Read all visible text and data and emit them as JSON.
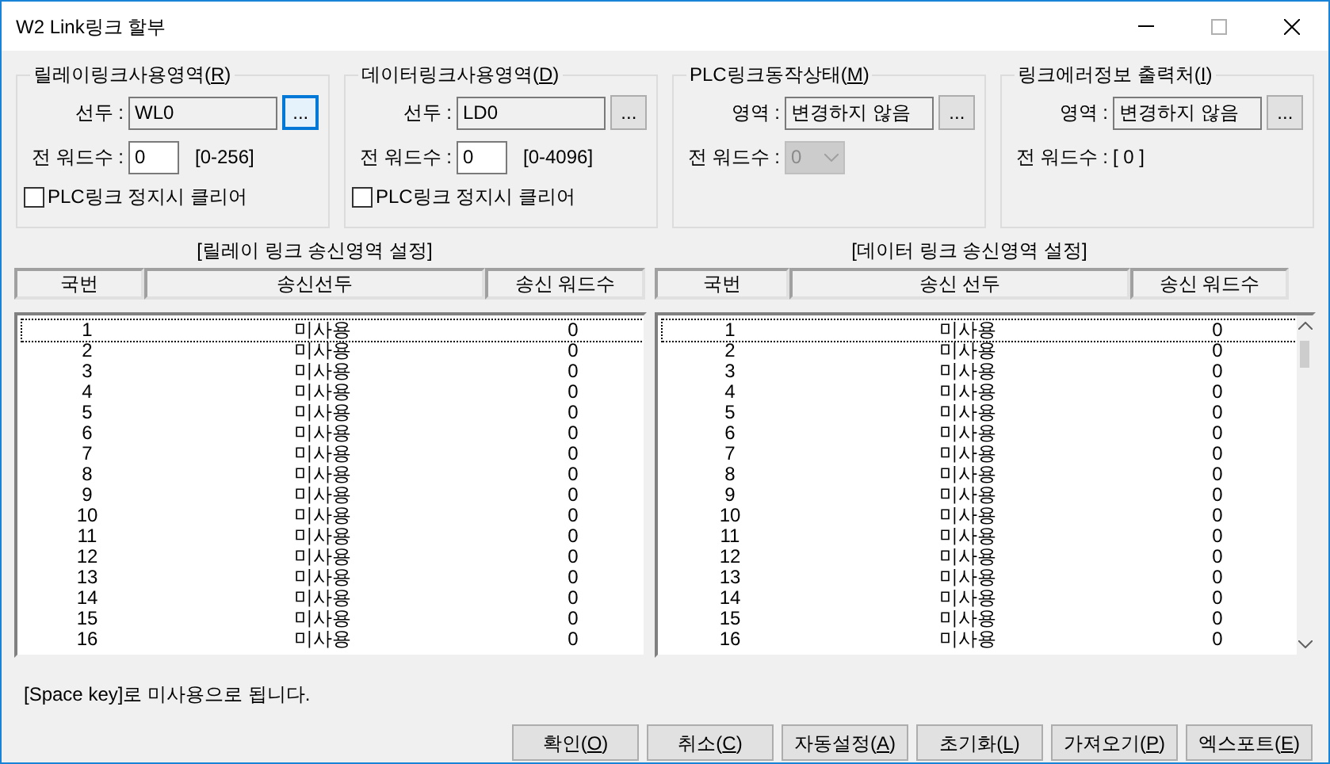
{
  "window": {
    "title": "W2 Link링크 할부"
  },
  "groups": [
    {
      "title": "릴레이링크사용영역(R)",
      "items": [
        {
          "kind": "field",
          "label": "선두 :",
          "value": "WL0",
          "button": "...",
          "focused": true
        },
        {
          "kind": "count",
          "label": "전 워드수 :",
          "value": "0",
          "hint": "[0-256]"
        },
        {
          "kind": "checkbox",
          "label": "PLC링크 정지시 클리어",
          "checked": false
        }
      ]
    },
    {
      "title": "데이터링크사용영역(D)",
      "items": [
        {
          "kind": "field",
          "label": "선두 :",
          "value": "LD0",
          "button": "...",
          "focused": false
        },
        {
          "kind": "count",
          "label": "전 워드수 :",
          "value": "0",
          "hint": "[0-4096]"
        },
        {
          "kind": "checkbox",
          "label": "PLC링크 정지시 클리어",
          "checked": false
        }
      ]
    },
    {
      "title": "PLC링크동작상태(M)",
      "items": [
        {
          "kind": "field",
          "label": "영역 :",
          "value": "변경하지 않음",
          "button": "...",
          "focused": false
        },
        {
          "kind": "combo",
          "label": "전 워드수 :",
          "value": "0",
          "disabled": true
        }
      ]
    },
    {
      "title": "링크에러정보 출력처(I)",
      "items": [
        {
          "kind": "field",
          "label": "영역 :",
          "value": "변경하지 않음",
          "button": "...",
          "focused": false
        },
        {
          "kind": "reading",
          "label": "전 워드수 :",
          "value": "[ 0 ]"
        }
      ]
    }
  ],
  "tables": [
    {
      "title": "[릴레이 링크 송신영역 설정]",
      "columns": [
        "국번",
        "송신선두",
        "송신 워드수"
      ],
      "rows": [
        {
          "no": "1",
          "prefix": "미사용",
          "words": "0",
          "selected": true
        },
        {
          "no": "2",
          "prefix": "미사용",
          "words": "0",
          "selected": false
        },
        {
          "no": "3",
          "prefix": "미사용",
          "words": "0",
          "selected": false
        },
        {
          "no": "4",
          "prefix": "미사용",
          "words": "0",
          "selected": false
        },
        {
          "no": "5",
          "prefix": "미사용",
          "words": "0",
          "selected": false
        },
        {
          "no": "6",
          "prefix": "미사용",
          "words": "0",
          "selected": false
        },
        {
          "no": "7",
          "prefix": "미사용",
          "words": "0",
          "selected": false
        },
        {
          "no": "8",
          "prefix": "미사용",
          "words": "0",
          "selected": false
        },
        {
          "no": "9",
          "prefix": "미사용",
          "words": "0",
          "selected": false
        },
        {
          "no": "10",
          "prefix": "미사용",
          "words": "0",
          "selected": false
        },
        {
          "no": "11",
          "prefix": "미사용",
          "words": "0",
          "selected": false
        },
        {
          "no": "12",
          "prefix": "미사용",
          "words": "0",
          "selected": false
        },
        {
          "no": "13",
          "prefix": "미사용",
          "words": "0",
          "selected": false
        },
        {
          "no": "14",
          "prefix": "미사용",
          "words": "0",
          "selected": false
        },
        {
          "no": "15",
          "prefix": "미사용",
          "words": "0",
          "selected": false
        },
        {
          "no": "16",
          "prefix": "미사용",
          "words": "0",
          "selected": false
        }
      ]
    },
    {
      "title": "[데이터 링크 송신영역 설정]",
      "columns": [
        "국번",
        "송신 선두",
        "송신 워드수"
      ],
      "rows": [
        {
          "no": "1",
          "prefix": "미사용",
          "words": "0",
          "selected": true
        },
        {
          "no": "2",
          "prefix": "미사용",
          "words": "0",
          "selected": false
        },
        {
          "no": "3",
          "prefix": "미사용",
          "words": "0",
          "selected": false
        },
        {
          "no": "4",
          "prefix": "미사용",
          "words": "0",
          "selected": false
        },
        {
          "no": "5",
          "prefix": "미사용",
          "words": "0",
          "selected": false
        },
        {
          "no": "6",
          "prefix": "미사용",
          "words": "0",
          "selected": false
        },
        {
          "no": "7",
          "prefix": "미사용",
          "words": "0",
          "selected": false
        },
        {
          "no": "8",
          "prefix": "미사용",
          "words": "0",
          "selected": false
        },
        {
          "no": "9",
          "prefix": "미사용",
          "words": "0",
          "selected": false
        },
        {
          "no": "10",
          "prefix": "미사용",
          "words": "0",
          "selected": false
        },
        {
          "no": "11",
          "prefix": "미사용",
          "words": "0",
          "selected": false
        },
        {
          "no": "12",
          "prefix": "미사용",
          "words": "0",
          "selected": false
        },
        {
          "no": "13",
          "prefix": "미사용",
          "words": "0",
          "selected": false
        },
        {
          "no": "14",
          "prefix": "미사용",
          "words": "0",
          "selected": false
        },
        {
          "no": "15",
          "prefix": "미사용",
          "words": "0",
          "selected": false
        },
        {
          "no": "16",
          "prefix": "미사용",
          "words": "0",
          "selected": false
        }
      ]
    }
  ],
  "note": "[Space key]로 미사용으로 됩니다.",
  "buttons": [
    "확인(O)",
    "취소(C)",
    "자동설정(A)",
    "초기화(L)",
    "가져오기(P)",
    "엑스포트(E)"
  ]
}
